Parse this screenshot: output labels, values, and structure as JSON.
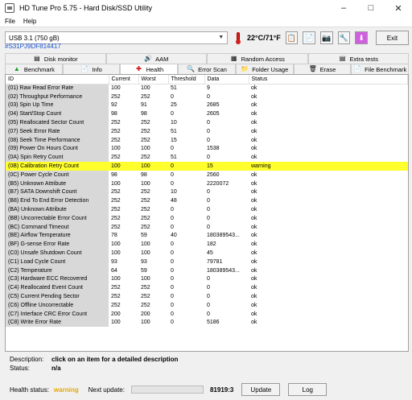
{
  "window": {
    "title": "HD Tune Pro 5.75 - Hard Disk/SSD Utility"
  },
  "menu": {
    "items": [
      {
        "label": "File"
      },
      {
        "label": "Help"
      }
    ]
  },
  "toolbar": {
    "drive": "USB    3.1 (750 gB)",
    "temperature": "22°C/71°F",
    "exit_label": "Exit"
  },
  "serial": "#S31PJ9DF814417",
  "tabs": {
    "row1": [
      {
        "label": "Disk monitor",
        "icon": "disk-monitor-icon"
      },
      {
        "label": "AAM",
        "icon": "speaker-icon"
      },
      {
        "label": "Random Access",
        "icon": "random-access-icon"
      },
      {
        "label": "Extra tests",
        "icon": "extra-tests-icon"
      }
    ],
    "row2": [
      {
        "label": "Benchmark",
        "icon": "benchmark-icon"
      },
      {
        "label": "Info",
        "icon": "info-icon"
      },
      {
        "label": "Health",
        "icon": "health-cross-icon"
      },
      {
        "label": "Error Scan",
        "icon": "magnifier-icon"
      },
      {
        "label": "Folder Usage",
        "icon": "folder-icon"
      },
      {
        "label": "Erase",
        "icon": "trash-icon"
      },
      {
        "label": "File Benchmark",
        "icon": "file-benchmark-icon"
      }
    ],
    "active": "Health"
  },
  "table": {
    "columns": [
      "ID",
      "Current",
      "Worst",
      "Threshold",
      "Data",
      "Status"
    ],
    "rows": [
      [
        "(01) Raw Read Error Rate",
        "100",
        "100",
        "51",
        "9",
        "ok"
      ],
      [
        "(02) Throughput Performance",
        "252",
        "252",
        "0",
        "0",
        "ok"
      ],
      [
        "(03) Spin Up Time",
        "92",
        "91",
        "25",
        "2685",
        "ok"
      ],
      [
        "(04) Start/Stop Count",
        "98",
        "98",
        "0",
        "2605",
        "ok"
      ],
      [
        "(05) Reallocated Sector Count",
        "252",
        "252",
        "10",
        "0",
        "ok"
      ],
      [
        "(07) Seek Error Rate",
        "252",
        "252",
        "51",
        "0",
        "ok"
      ],
      [
        "(08) Seek Time Performance",
        "252",
        "252",
        "15",
        "0",
        "ok"
      ],
      [
        "(09) Power On Hours Count",
        "100",
        "100",
        "0",
        "1538",
        "ok"
      ],
      [
        "(0A) Spin Retry Count",
        "252",
        "252",
        "51",
        "0",
        "ok"
      ],
      [
        "(0B) Calibration Retry Count",
        "100",
        "100",
        "0",
        "15",
        "warning"
      ],
      [
        "(0C) Power Cycle Count",
        "98",
        "98",
        "0",
        "2560",
        "ok"
      ],
      [
        "(B5) Unknown Attribute",
        "100",
        "100",
        "0",
        "2220072",
        "ok"
      ],
      [
        "(B7) SATA Downshift Count",
        "252",
        "252",
        "10",
        "0",
        "ok"
      ],
      [
        "(B8) End To End Error Detection",
        "252",
        "252",
        "48",
        "0",
        "ok"
      ],
      [
        "(BA) Unknown Attribute",
        "252",
        "252",
        "0",
        "0",
        "ok"
      ],
      [
        "(BB) Uncorrectable Error Count",
        "252",
        "252",
        "0",
        "0",
        "ok"
      ],
      [
        "(BC) Command Timeout",
        "252",
        "252",
        "0",
        "0",
        "ok"
      ],
      [
        "(BE) Airflow Temperature",
        "78",
        "59",
        "40",
        "180389543...",
        "ok"
      ],
      [
        "(BF) G-sense Error Rate",
        "100",
        "100",
        "0",
        "182",
        "ok"
      ],
      [
        "(C0) Unsafe Shutdown Count",
        "100",
        "100",
        "0",
        "45",
        "ok"
      ],
      [
        "(C1) Load Cycle Count",
        "93",
        "93",
        "0",
        "79781",
        "ok"
      ],
      [
        "(C2) Temperature",
        "64",
        "59",
        "0",
        "180389543...",
        "ok"
      ],
      [
        "(C3) Hardware ECC Recovered",
        "100",
        "100",
        "0",
        "0",
        "ok"
      ],
      [
        "(C4) Reallocated Event Count",
        "252",
        "252",
        "0",
        "0",
        "ok"
      ],
      [
        "(C5) Current Pending Sector",
        "252",
        "252",
        "0",
        "0",
        "ok"
      ],
      [
        "(C6) Offline Uncorrectable",
        "252",
        "252",
        "0",
        "0",
        "ok"
      ],
      [
        "(C7) Interface CRC Error Count",
        "200",
        "200",
        "0",
        "0",
        "ok"
      ],
      [
        "(C8) Write Error Rate",
        "100",
        "100",
        "0",
        "5186",
        "ok"
      ]
    ]
  },
  "description": {
    "label": "Description:",
    "value": "click on an item for a detailed description"
  },
  "status_info": {
    "label": "Status:",
    "value": "n/a"
  },
  "footer": {
    "health_label": "Health status:",
    "health_value": "warning",
    "next_label": "Next update:",
    "next_progress": 0.0,
    "next_value": "81919:3",
    "update_label": "Update",
    "log_label": "Log"
  },
  "colors": {
    "warning_row": "#ffff2e",
    "serial_link": "#1a55d0",
    "health_warning": "#e6a800"
  }
}
